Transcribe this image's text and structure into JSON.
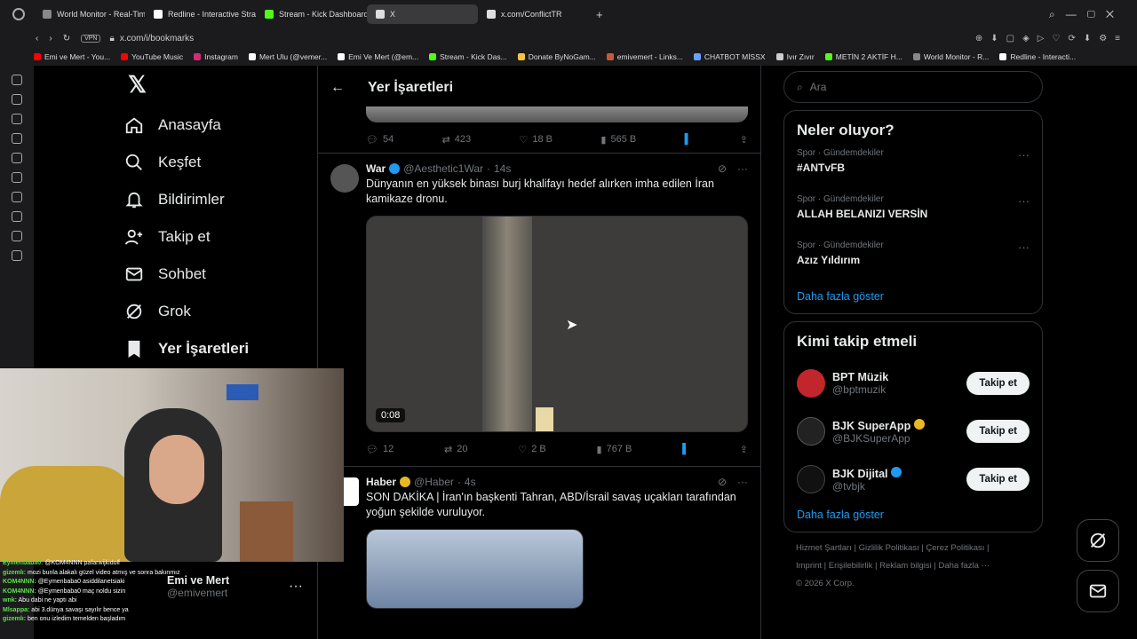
{
  "browser": {
    "tabs": [
      {
        "label": "World Monitor - Real-Time",
        "color": "#888"
      },
      {
        "label": "Redline - Interactive Strate",
        "color": "#fff"
      },
      {
        "label": "Stream - Kick Dashboard",
        "color": "#53fc18"
      },
      {
        "label": "X",
        "color": "#ddd"
      },
      {
        "label": "x.com/ConflictTR",
        "color": "#ddd"
      }
    ],
    "vpn": "VPN",
    "url": "x.com/i/bookmarks",
    "bookmarks": [
      {
        "label": "Emi ve Mert - You...",
        "color": "#ff0000"
      },
      {
        "label": "YouTube Music",
        "color": "#ff0000"
      },
      {
        "label": "Instagram",
        "color": "#d62976"
      },
      {
        "label": "Mert Ulu (@vemer...",
        "color": "#ffffff"
      },
      {
        "label": "Emi Ve Mert (@em...",
        "color": "#ffffff"
      },
      {
        "label": "Stream - Kick Das...",
        "color": "#53fc18"
      },
      {
        "label": "Donate ByNoGam...",
        "color": "#f5c542"
      },
      {
        "label": "emivemert - Links...",
        "color": "#c65a3a"
      },
      {
        "label": "CHATBOT MİSSX",
        "color": "#6aa0ff"
      },
      {
        "label": "Ivır Zıvır",
        "color": "#cccccc"
      },
      {
        "label": "METİN 2 AKTİF H...",
        "color": "#53fc18"
      },
      {
        "label": "World Monitor - R...",
        "color": "#888888"
      },
      {
        "label": "Redline - Interacti...",
        "color": "#ffffff"
      }
    ]
  },
  "nav": {
    "items": [
      {
        "label": "Anasayfa",
        "icon": "home-icon"
      },
      {
        "label": "Keşfet",
        "icon": "search-icon"
      },
      {
        "label": "Bildirimler",
        "icon": "bell-icon"
      },
      {
        "label": "Takip et",
        "icon": "person-add-icon"
      },
      {
        "label": "Sohbet",
        "icon": "mail-icon"
      },
      {
        "label": "Grok",
        "icon": "grok-icon"
      },
      {
        "label": "Yer İşaretleri",
        "icon": "bookmark-icon"
      }
    ],
    "profile": {
      "name": "Emi ve Mert",
      "handle": "@emivemert"
    }
  },
  "main": {
    "title": "Yer İşaretleri",
    "first_actions": {
      "replies": "54",
      "retweets": "423",
      "likes": "18 B",
      "views": "565 B"
    },
    "tweets": [
      {
        "author": "War",
        "handle": "@Aesthetic1War",
        "time": "14s",
        "text": "Dünyanın en yüksek binası burj khalifayı hedef alırken imha edilen İran kamikaze dronu.",
        "duration": "0:08",
        "replies": "12",
        "retweets": "20",
        "likes": "2 B",
        "views": "767 B"
      },
      {
        "author": "Haber",
        "handle": "@Haber",
        "time": "4s",
        "text": "SON DAKİKA | İran'ın başkenti Tahran, ABD/İsrail savaş uçakları tarafından yoğun şekilde vuruluyor."
      }
    ]
  },
  "sidebar": {
    "search_placeholder": "Ara",
    "trends_title": "Neler oluyor?",
    "trends": [
      {
        "meta": "Spor · Gündemdekiler",
        "name": "#ANTvFB"
      },
      {
        "meta": "Spor · Gündemdekiler",
        "name": "ALLAH BELANIZI VERSİN"
      },
      {
        "meta": "Spor · Gündemdekiler",
        "name": "Azız Yıldırım"
      }
    ],
    "show_more": "Daha fazla göster",
    "who_title": "Kimi takip etmeli",
    "who": [
      {
        "name": "BPT Müzik",
        "handle": "@bptmuzik",
        "color": "#c0262c"
      },
      {
        "name": "BJK SuperApp",
        "handle": "@BJKSuperApp",
        "color": "#222222"
      },
      {
        "name": "BJK Dijital",
        "handle": "@tvbjk",
        "color": "#111111"
      }
    ],
    "follow_label": "Takip et",
    "show_more2": "Daha fazla göster",
    "footer": {
      "l1": "Hizmet Şartları   |   Gizlilik Politikası   |   Çerez Politikası   |",
      "l2": "Imprint   |   Erişilebilirlik   |   Reklam bilgisi   |   Daha fazla ···",
      "l3": "© 2026 X Corp."
    }
  },
  "chat": [
    {
      "user": "Eymenbaba0:",
      "msg": "@KOM4NNN pafarwijkidolf"
    },
    {
      "user": "gizemlı:",
      "msg": "mozi bunla alakalı güzel video atmış ve sonra bakınmız"
    },
    {
      "user": "KOM4NNN:",
      "msg": "@Eymenbaba0 asiddilanetsiaki"
    },
    {
      "user": "KOM4NNN:",
      "msg": "@Eymenbaba0 maç noldu sizin"
    },
    {
      "user": "wnk:",
      "msg": "Abu dabi ne yaptı abi"
    },
    {
      "user": "Mlsappa:",
      "msg": "abi 3.dünya savaşı sayılır bence ya"
    },
    {
      "user": "gizemlı:",
      "msg": "ben onu izledim temelden başladım"
    }
  ]
}
